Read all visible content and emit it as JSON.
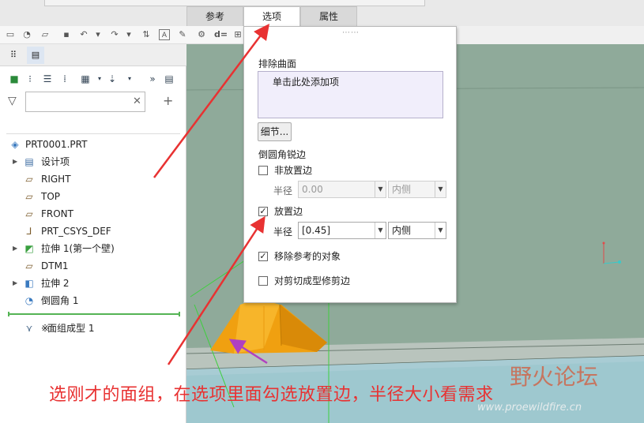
{
  "tabs": [
    {
      "label": "参考"
    },
    {
      "label": "选项"
    },
    {
      "label": "属性"
    }
  ],
  "model_tree": {
    "filter_placeholder": "",
    "root": "PRT0001.PRT",
    "items": [
      {
        "label": "设计项",
        "icon": "layers-icon",
        "expandable": true
      },
      {
        "label": "RIGHT",
        "icon": "datum-plane-icon",
        "expandable": false
      },
      {
        "label": "TOP",
        "icon": "datum-plane-icon",
        "expandable": false
      },
      {
        "label": "FRONT",
        "icon": "datum-plane-icon",
        "expandable": false
      },
      {
        "label": "PRT_CSYS_DEF",
        "icon": "csys-icon",
        "expandable": false
      },
      {
        "label": "拉伸 1(第一个壁)",
        "icon": "extrude-wall-icon",
        "expandable": true
      },
      {
        "label": "DTM1",
        "icon": "datum-plane-icon",
        "expandable": false
      },
      {
        "label": "拉伸 2",
        "icon": "extrude-icon",
        "expandable": true
      },
      {
        "label": "倒圆角 1",
        "icon": "round-icon",
        "expandable": false
      }
    ],
    "new_item": {
      "label": "面组成型 1",
      "prefix": "※",
      "icon": "form-icon"
    }
  },
  "options_panel": {
    "exclude_title": "排除曲面",
    "exclude_hint": "单击此处添加项",
    "detail_button": "细节...",
    "round_title": "倒圆角锐边",
    "non_placement": {
      "label": "非放置边",
      "checked": false,
      "radius_label": "半径",
      "radius_value": "0.00",
      "side_value": "内侧"
    },
    "placement": {
      "label": "放置边",
      "checked": true,
      "radius_label": "半径",
      "radius_value": "[0.45]",
      "side_value": "内侧"
    },
    "remove_refs": {
      "label": "移除参考的对象",
      "checked": true
    },
    "trim_cut": {
      "label": "对剪切成型修剪边",
      "checked": false
    }
  },
  "caption": "选刚才的面组，在选项里面勾选放置边，半径大小看需求",
  "watermark": {
    "logo": "野火论坛",
    "url": "www.proewildfire.cn"
  },
  "colors": {
    "viewport_bg": "#8faa9a",
    "part_orange": "#f0a010",
    "annotation_red": "#e83232",
    "arrow_purple": "#b040c0",
    "panel_input_bg": "#f1eefb"
  }
}
